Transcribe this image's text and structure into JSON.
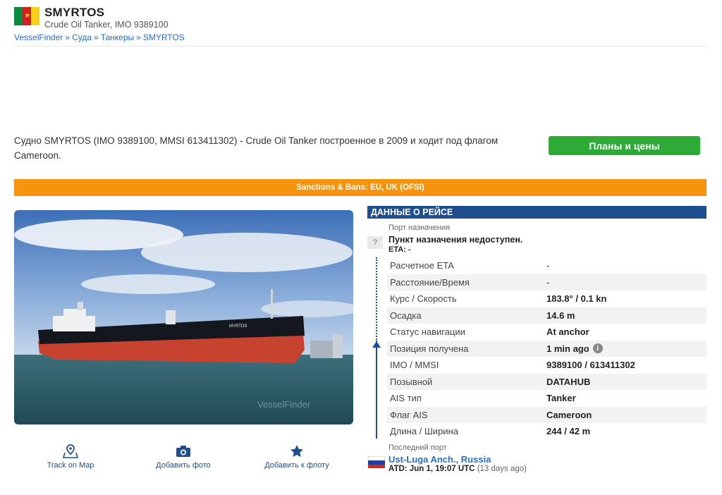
{
  "header": {
    "vessel_name": "SMYRTOS",
    "vessel_subtitle": "Crude Oil Tanker, IMO 9389100",
    "breadcrumb": [
      "VesselFinder",
      "Суда",
      "Танкеры",
      "SMYRTOS"
    ],
    "breadcrumb_separator": "»",
    "flag_icon": "cameroon-flag-icon"
  },
  "description": "Судно SMYRTOS (IMO 9389100, MMSI 613411302) - Crude Oil Tanker построенное в 2009 и ходит под флагом Cameroon.",
  "plans_button": "Планы и цены",
  "sanctions_banner": "Sanctions & Bans: EU, UK (OFSI)",
  "photo": {
    "hull_name": "MYRTOS",
    "watermark": "VesselFinder"
  },
  "actions": [
    {
      "label": "Track on Map",
      "icon": "map-pin-icon"
    },
    {
      "label": "Добавить фото",
      "icon": "camera-icon"
    },
    {
      "label": "Добавить к флоту",
      "icon": "star-icon"
    }
  ],
  "voyage": {
    "title": "ДАННЫЕ О РЕЙСЕ",
    "destination_label": "Порт назначения",
    "destination_marker": "?",
    "destination_value": "Пункт назначения недоступен.",
    "eta": "ETA: -",
    "rows": [
      {
        "key": "Расчетное ETA",
        "value": "-"
      },
      {
        "key": "Расстояние/Время",
        "value": "-"
      },
      {
        "key": "Курс / Скорость",
        "value": "183.8° / 0.1 kn"
      },
      {
        "key": "Осадка",
        "value": "14.6 m"
      },
      {
        "key": "Статус навигации",
        "value": "At anchor"
      },
      {
        "key": "Позиция получена",
        "value": "1 min ago"
      },
      {
        "key": "IMO / MMSI",
        "value": "9389100 / 613411302"
      },
      {
        "key": "Позывной",
        "value": "DATAHUB"
      },
      {
        "key": "AIS тип",
        "value": "Tanker"
      },
      {
        "key": "Флаг AIS",
        "value": "Cameroon"
      },
      {
        "key": "Длина / Ширина",
        "value": "244 / 42 m"
      }
    ],
    "info_marker": "i",
    "last_port_label": "Последний порт",
    "last_port": "Ust-Luga Anch., Russia",
    "atd": "ATD: Jun 1, 19:07 UTC",
    "atd_ago": "(13 days ago)"
  },
  "colors": {
    "brand_blue": "#1d4f91",
    "link_blue": "#2a6fc9",
    "green_button": "#2dab36",
    "sanctions_orange": "#f7940e"
  }
}
